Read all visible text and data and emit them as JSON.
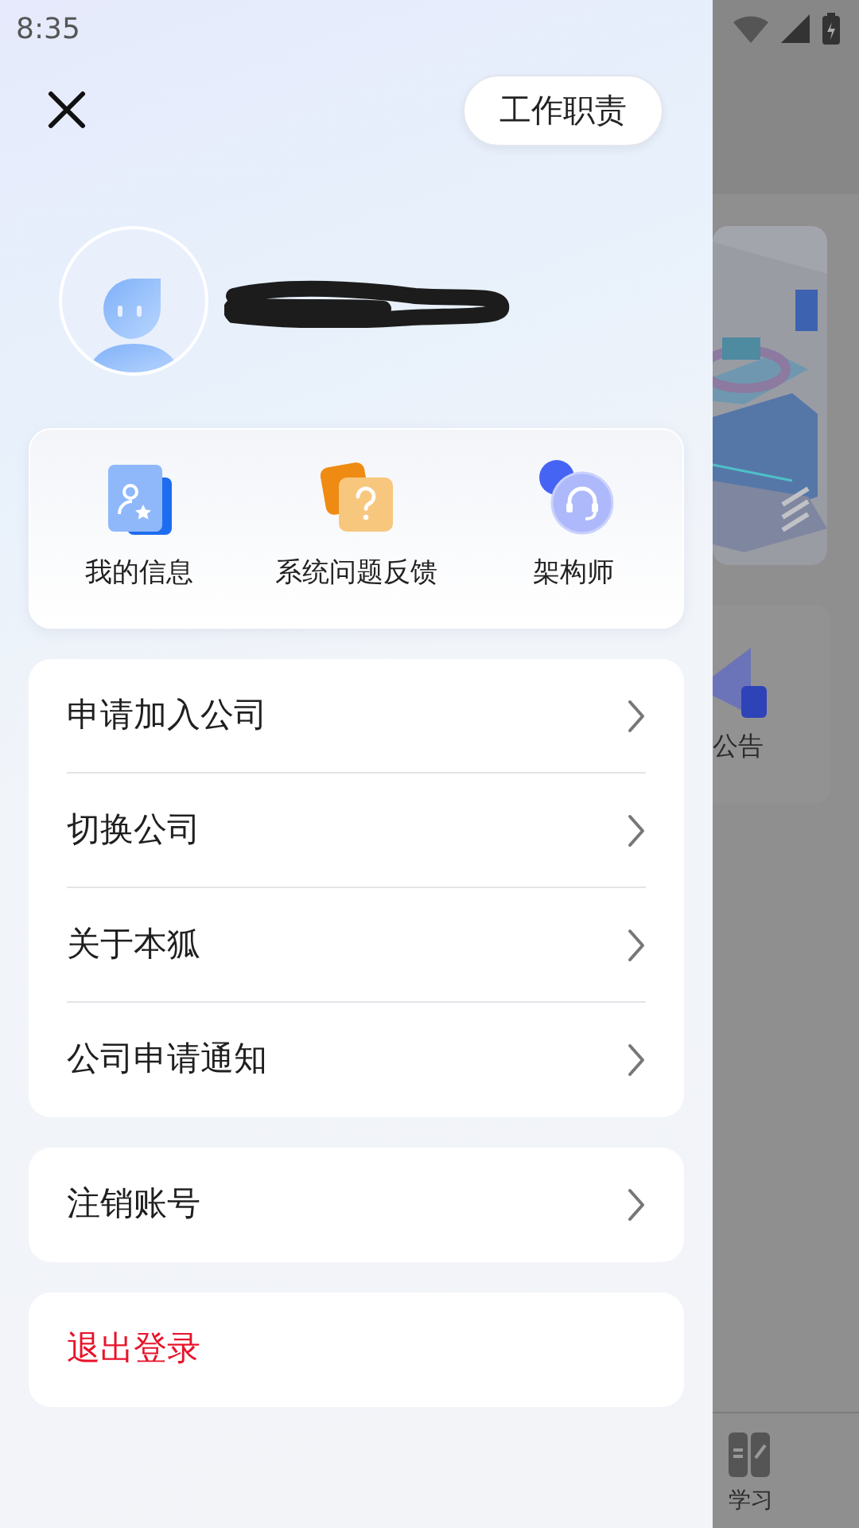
{
  "status_bar": {
    "time": "8:35"
  },
  "header": {
    "role_button": "工作职责"
  },
  "shortcuts": [
    {
      "label": "我的信息",
      "kind": "profile"
    },
    {
      "label": "系统问题反馈",
      "kind": "feedback"
    },
    {
      "label": "架构师",
      "kind": "support"
    }
  ],
  "menu_groups": [
    {
      "items": [
        {
          "label": "申请加入公司",
          "kind": "link"
        },
        {
          "label": "切换公司",
          "kind": "link"
        },
        {
          "label": "关于本狐",
          "kind": "link"
        },
        {
          "label": "公司申请通知",
          "kind": "link"
        }
      ]
    },
    {
      "items": [
        {
          "label": "注销账号",
          "kind": "link"
        }
      ]
    },
    {
      "items": [
        {
          "label": "退出登录",
          "kind": "danger"
        }
      ]
    }
  ],
  "background": {
    "card_label": "公告",
    "tab_label": "学习"
  }
}
